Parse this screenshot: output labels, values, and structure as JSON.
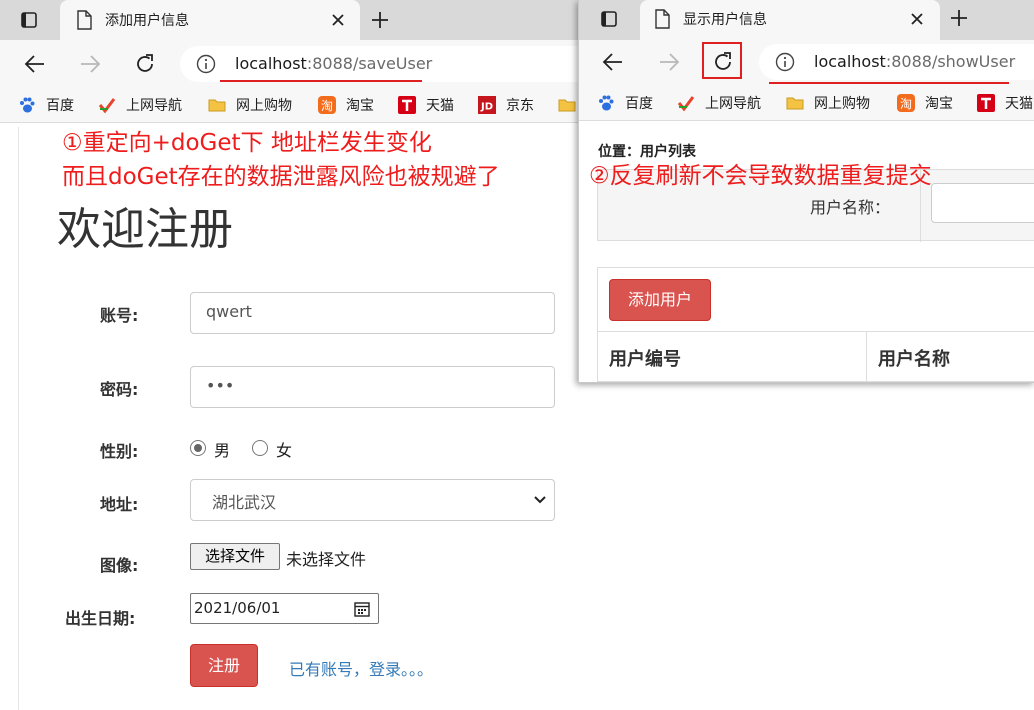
{
  "left_window": {
    "tab_title": "添加用户信息",
    "url_host": "localhost",
    "url_rest": ":8088/saveUser",
    "bookmarks": [
      "百度",
      "上网导航",
      "网上购物",
      "淘宝",
      "天猫",
      "京东"
    ],
    "annotation_line1": "①重定向+doGet下 地址栏发生变化",
    "annotation_line2": "而且doGet存在的数据泄露风险也被规避了",
    "form": {
      "heading": "欢迎注册",
      "account_label": "账号:",
      "account_value": "qwert",
      "password_label": "密码:",
      "password_value": "•••",
      "gender_label": "性别:",
      "gender_male": "男",
      "gender_female": "女",
      "gender_selected": "男",
      "address_label": "地址:",
      "address_value": "湖北武汉",
      "image_label": "图像:",
      "file_button": "选择文件",
      "file_status": "未选择文件",
      "birthday_label": "出生日期:",
      "birthday_value": "2021/06/01",
      "submit_label": "注册",
      "login_link": "已有账号，登录。。。"
    }
  },
  "right_window": {
    "tab_title": "显示用户信息",
    "url_host": "localhost",
    "url_rest": ":8088/showUser",
    "bookmarks": [
      "百度",
      "上网导航",
      "网上购物",
      "淘宝",
      "天猫"
    ],
    "location_text": "位置：用户列表",
    "annotation": "②反复刷新不会导致数据重复提交",
    "search_label": "用户名称：",
    "add_button": "添加用户",
    "table_headers": [
      "用户编号",
      "用户名称"
    ]
  }
}
